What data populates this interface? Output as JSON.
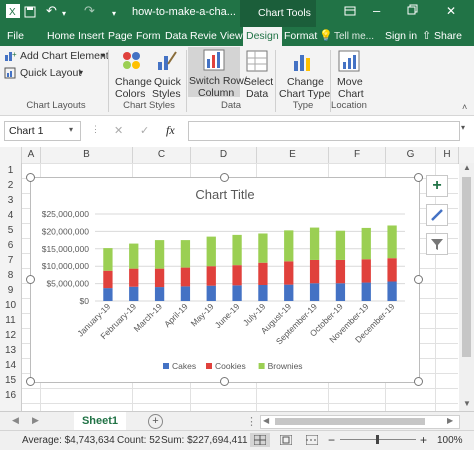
{
  "titlebar": {
    "file_name": "how-to-make-a-cha...",
    "context_label": "Chart Tools"
  },
  "tabs": [
    "File",
    "Home",
    "Insert",
    "Page",
    "Form",
    "Data",
    "Revie",
    "View",
    "Design",
    "Format"
  ],
  "tell_me": "Tell me...",
  "sign_in": "Sign in",
  "share": "Share",
  "ribbon": {
    "add_chart_element": "Add Chart Element",
    "quick_layout": "Quick Layout",
    "change_colors_1": "Change",
    "change_colors_2": "Colors",
    "quick_styles_1": "Quick",
    "quick_styles_2": "Styles",
    "switch_rowcol_1": "Switch Row/",
    "switch_rowcol_2": "Column",
    "select_data_1": "Select",
    "select_data_2": "Data",
    "change_type_1": "Change",
    "change_type_2": "Chart Type",
    "move_chart_1": "Move",
    "move_chart_2": "Chart",
    "groups": [
      "Chart Layouts",
      "Chart Styles",
      "Data",
      "Type",
      "Location"
    ]
  },
  "formula_bar": {
    "name_box": "Chart 1",
    "fx": "fx",
    "cancel": "✕",
    "enter": "✓"
  },
  "columns": [
    "A",
    "B",
    "C",
    "D",
    "E",
    "F",
    "G",
    "H"
  ],
  "rows": [
    "1",
    "2",
    "3",
    "4",
    "5",
    "6",
    "7",
    "8",
    "9",
    "10",
    "11",
    "12",
    "13",
    "14",
    "15",
    "16"
  ],
  "chart_data": {
    "type": "bar",
    "stacked": true,
    "title": "Chart Title",
    "categories": [
      "January-19",
      "February-19",
      "March-19",
      "April-19",
      "May-19",
      "June-19",
      "July-19",
      "August-19",
      "September-19",
      "October-19",
      "November-19",
      "December-19"
    ],
    "series": [
      {
        "name": "Cakes",
        "color": "#4472c4",
        "values": [
          3700000,
          4100000,
          4000000,
          4200000,
          4400000,
          4500000,
          4600000,
          4700000,
          5100000,
          5100000,
          5300000,
          5600000
        ]
      },
      {
        "name": "Cookies",
        "color": "#e0413c",
        "values": [
          5000000,
          5200000,
          5300000,
          5400000,
          5600000,
          5800000,
          6400000,
          6700000,
          6700000,
          6700000,
          6700000,
          6700000
        ]
      },
      {
        "name": "Brownies",
        "color": "#9bcf53",
        "values": [
          6500000,
          7200000,
          8200000,
          7900000,
          8500000,
          8700000,
          8400000,
          8900000,
          9300000,
          8400000,
          9000000,
          9400000
        ]
      }
    ],
    "y_ticks": [
      "$0",
      "$5,000,000",
      "$10,000,000",
      "$15,000,000",
      "$20,000,000",
      "$25,000,000"
    ],
    "ylim": [
      0,
      25000000
    ],
    "legend": "bottom",
    "grid": true
  },
  "sheet_tab": "Sheet1",
  "status": {
    "average": "Average: $4,743,634",
    "count": "Count: 52",
    "sum": "Sum: $227,694,411",
    "zoom": "100%"
  },
  "colors": {
    "excel_green": "#217346"
  }
}
